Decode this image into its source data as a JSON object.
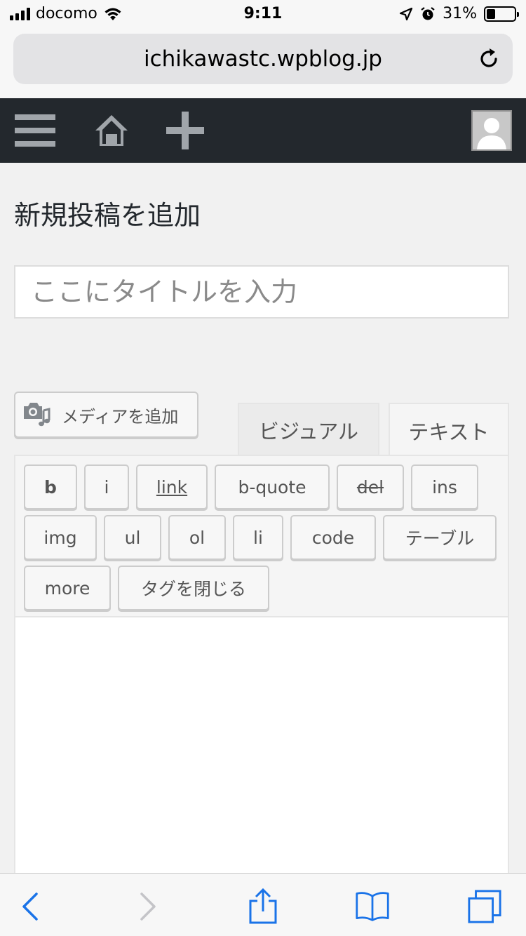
{
  "status": {
    "carrier": "docomo",
    "time": "9:11",
    "battery_percent": "31%",
    "battery_level": 0.31
  },
  "browser": {
    "url": "ichikawastc.wpblog.jp",
    "reload_icon": "reload-icon"
  },
  "adminbar": {
    "menu_icon": "hamburger-menu-icon",
    "home_icon": "home-icon",
    "new_icon": "plus-icon",
    "avatar_icon": "avatar-icon"
  },
  "page": {
    "title": "新規投稿を追加",
    "title_placeholder": "ここにタイトルを入力",
    "media_button": "メディアを追加",
    "tabs": [
      "ビジュアル",
      "テキスト"
    ],
    "active_tab": "テキスト"
  },
  "quicktags": [
    "b",
    "i",
    "link",
    "b-quote",
    "del",
    "ins",
    "img",
    "ul",
    "ol",
    "li",
    "code",
    "テーブル",
    "more",
    "タグを閉じる"
  ],
  "toolbar": {
    "icons": [
      "back-icon",
      "forward-icon",
      "share-icon",
      "bookmarks-icon",
      "tabs-icon"
    ]
  },
  "colors": {
    "adminbar": "#23282d",
    "accent": "#1a73e8",
    "background": "#f1f1f1"
  }
}
